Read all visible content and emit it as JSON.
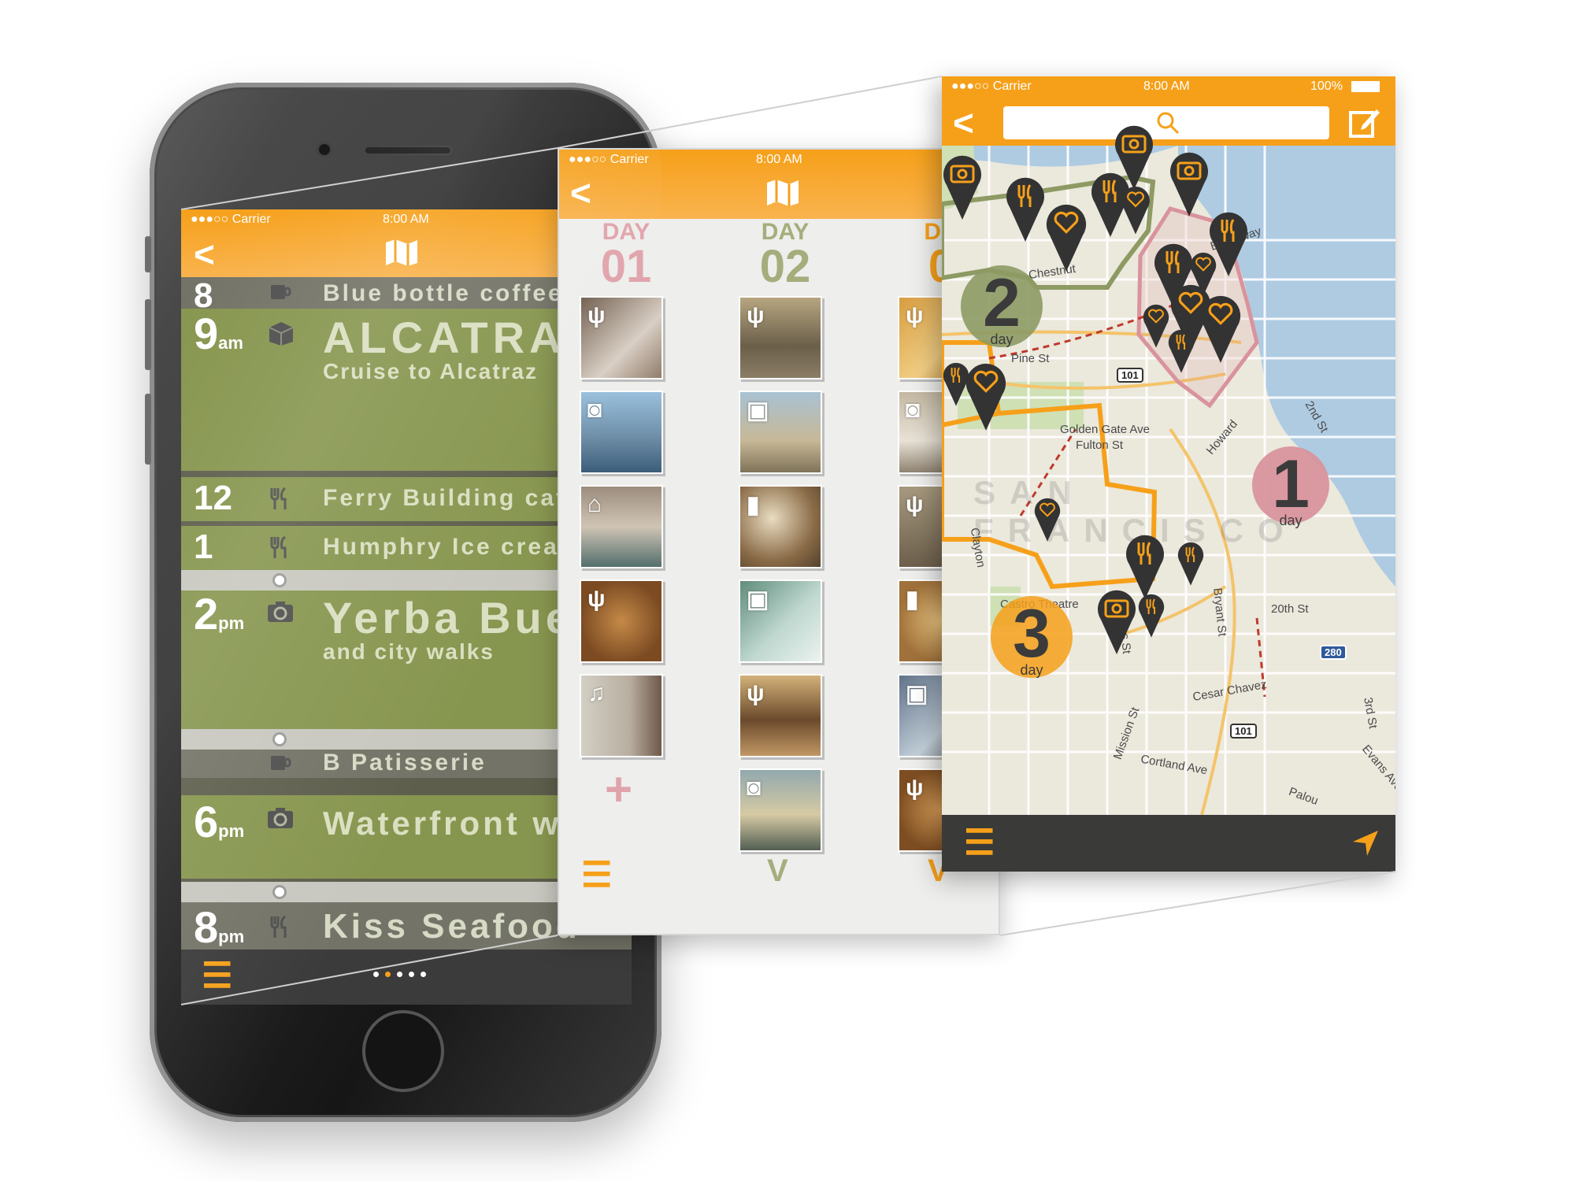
{
  "status_bar": {
    "carrier": "●●●○○ Carrier",
    "time": "8:00 AM",
    "battery": "100%"
  },
  "timeline": {
    "back_label": "<",
    "items": [
      {
        "hour": "8",
        "suffix": "",
        "category_icon": "coffee-icon",
        "title": "Blue bottle coffee",
        "subtitle": ""
      },
      {
        "hour": "9",
        "suffix": "am",
        "category_icon": "museum-icon",
        "title": "ALCATRAZ",
        "subtitle": "Cruise to Alcatraz"
      },
      {
        "hour": "12",
        "suffix": "",
        "category_icon": "restaurant-icon",
        "title": "Ferry Building cafe",
        "subtitle": ""
      },
      {
        "hour": "1",
        "suffix": "",
        "category_icon": "restaurant-icon",
        "title": "Humphry Ice cream",
        "subtitle": ""
      },
      {
        "hour": "2",
        "suffix": "pm",
        "category_icon": "camera-icon",
        "title": "Yerba Buena",
        "subtitle": "and city walks"
      },
      {
        "hour": "",
        "suffix": "",
        "category_icon": "coffee-icon",
        "title": "B Patisserie",
        "subtitle": ""
      },
      {
        "hour": "6",
        "suffix": "pm",
        "category_icon": "camera-icon",
        "title": "Waterfront walk",
        "subtitle": ""
      },
      {
        "hour": "8",
        "suffix": "pm",
        "category_icon": "restaurant-icon",
        "title": "Kiss Seafood",
        "subtitle": ""
      }
    ],
    "page_dots": 5,
    "active_dot": 1
  },
  "grid": {
    "days": [
      {
        "label": "DAY",
        "number": "01",
        "color": "#e0a3ab"
      },
      {
        "label": "DAY",
        "number": "02",
        "color": "#a5ad7c"
      },
      {
        "label": "DA",
        "number": "0",
        "color": "#f6a01a"
      }
    ],
    "add_label": "+",
    "expand_label": "V"
  },
  "map": {
    "streets": [
      "Broadway",
      "Chestnut",
      "Pine St",
      "Golden Gate Ave",
      "Fulton St",
      "Clayton",
      "Castro Theatre",
      "Dolores St",
      "Bryant St",
      "20th St",
      "Cesar Chavez",
      "Mission St",
      "Cortland Ave",
      "3rd St",
      "Evans Ave",
      "Howard",
      "2nd St",
      "Palou"
    ],
    "city_label": "SAN FRANCISCO",
    "highway_101": "101",
    "highway_280": "280",
    "day_badges": [
      {
        "number": "2",
        "label": "day",
        "color": "#8d9a63"
      },
      {
        "number": "1",
        "label": "day",
        "color": "#d9939d"
      },
      {
        "number": "3",
        "label": "day",
        "color": "#f6a01a"
      }
    ]
  }
}
